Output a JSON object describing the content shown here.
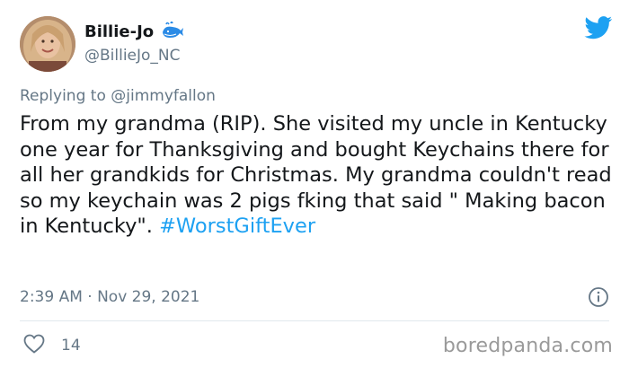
{
  "tweet": {
    "display_name": "Billie-Jo",
    "handle": "@BillieJo_NC",
    "reply_prefix": "Replying to",
    "reply_to": "@jimmyfallon",
    "text": "From my grandma (RIP). She visited my uncle in Kentucky one year for Thanksgiving and bought Keychains there for all her grandkids for Christmas. My grandma couldn't read so my keychain was 2 pigs fking that said \" Making bacon in Kentucky\". ",
    "hashtag": "#WorstGiftEver",
    "timestamp": "2:39 AM · Nov 29, 2021",
    "likes": "14"
  },
  "icons": {
    "badge": "whale-icon",
    "brand": "twitter-bird-icon",
    "info": "info-icon",
    "like": "heart-icon"
  },
  "colors": {
    "accent": "#1da1f2",
    "secondary_text": "#657786",
    "primary_text": "#14171a"
  },
  "watermark": "boredpanda.com"
}
